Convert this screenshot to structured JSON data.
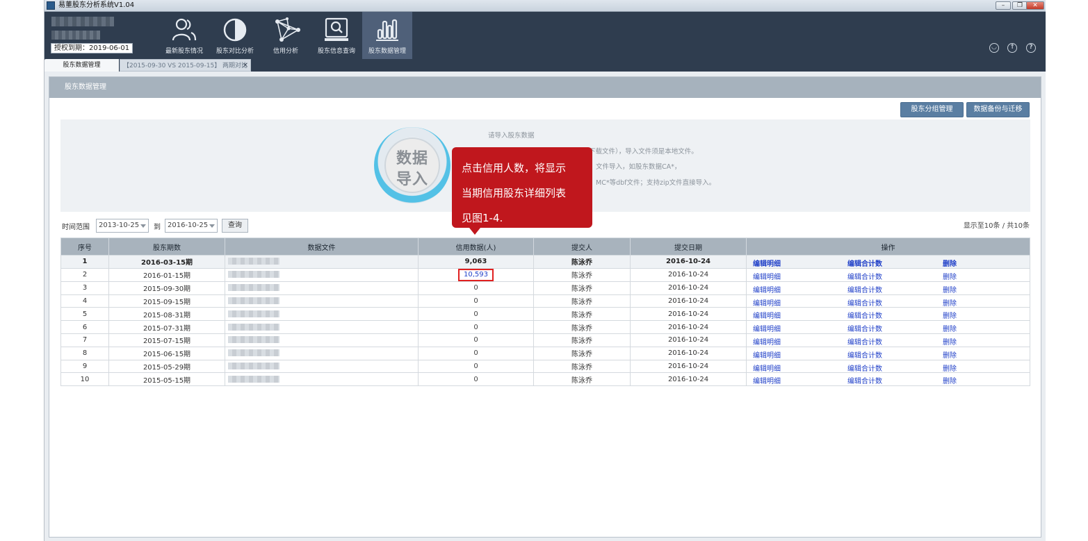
{
  "window": {
    "title": "易董股东分析系统V1.04",
    "controls": [
      "minimize",
      "restore",
      "close"
    ]
  },
  "header": {
    "auth_label": "授权到期：2019-06-01",
    "nav": [
      {
        "label": "最新股东情况",
        "icon": "users-icon"
      },
      {
        "label": "股东对比分析",
        "icon": "half-circle-icon"
      },
      {
        "label": "信用分析",
        "icon": "network-icon"
      },
      {
        "label": "股东信息查询",
        "icon": "search-monitor-icon"
      },
      {
        "label": "股东数据管理",
        "icon": "bar-chart-icon",
        "active": true
      }
    ],
    "right_icons": [
      "user-icon",
      "upload-icon",
      "help-icon"
    ]
  },
  "tabs": [
    {
      "label": "股东数据管理",
      "active": true
    },
    {
      "label": "【2015-09-30 VS 2015-09-15】 两期对比",
      "active": false
    }
  ],
  "panel": {
    "title": "股东数据管理",
    "buttons": {
      "group": "股东分组管理",
      "backup": "数据备份与迁移"
    }
  },
  "import": {
    "circle_line1": "数据",
    "circle_line2": "导入",
    "hint_title": "请导入股东数据",
    "hint1": "下载文件），导入文件须是本地文件。",
    "hint2": "文件导入，如股东数据CA*，",
    "hint3": "MC*等dbf文件；支持zip文件直接导入。"
  },
  "callout": {
    "line1": "点击信用人数，将显示",
    "line2": "当期信用股东详细列表",
    "line3": "见图1-4."
  },
  "filter": {
    "label": "时间范围",
    "from": "2013-10-25",
    "to_label": "到",
    "to": "2016-10-25",
    "query": "查询",
    "summary": "显示至10条 / 共10条"
  },
  "table": {
    "headers": [
      "序号",
      "股东期数",
      "数据文件",
      "信用数据(人)",
      "提交人",
      "提交日期",
      "操作"
    ],
    "op_labels": {
      "detail": "编辑明细",
      "total": "编辑合计数",
      "delete": "删除"
    },
    "rows": [
      {
        "no": "1",
        "period": "2016-03-15期",
        "credit": "9,063",
        "submitter": "陈泳乔",
        "date": "2016-10-24"
      },
      {
        "no": "2",
        "period": "2016-01-15期",
        "credit": "10,593",
        "submitter": "陈泳乔",
        "date": "2016-10-24"
      },
      {
        "no": "3",
        "period": "2015-09-30期",
        "credit": "0",
        "submitter": "陈泳乔",
        "date": "2016-10-24"
      },
      {
        "no": "4",
        "period": "2015-09-15期",
        "credit": "0",
        "submitter": "陈泳乔",
        "date": "2016-10-24"
      },
      {
        "no": "5",
        "period": "2015-08-31期",
        "credit": "0",
        "submitter": "陈泳乔",
        "date": "2016-10-24"
      },
      {
        "no": "6",
        "period": "2015-07-31期",
        "credit": "0",
        "submitter": "陈泳乔",
        "date": "2016-10-24"
      },
      {
        "no": "7",
        "period": "2015-07-15期",
        "credit": "0",
        "submitter": "陈泳乔",
        "date": "2016-10-24"
      },
      {
        "no": "8",
        "period": "2015-06-15期",
        "credit": "0",
        "submitter": "陈泳乔",
        "date": "2016-10-24"
      },
      {
        "no": "9",
        "period": "2015-05-29期",
        "credit": "0",
        "submitter": "陈泳乔",
        "date": "2016-10-24"
      },
      {
        "no": "10",
        "period": "2015-05-15期",
        "credit": "0",
        "submitter": "陈泳乔",
        "date": "2016-10-24"
      }
    ]
  },
  "colors": {
    "header_bg": "#2f3d4f",
    "nav_active": "#4f6079",
    "button_blue": "#5a7ea2",
    "link_blue": "#1f3fc8",
    "callout_red": "#c0171d",
    "highlight_red": "#e02020"
  }
}
